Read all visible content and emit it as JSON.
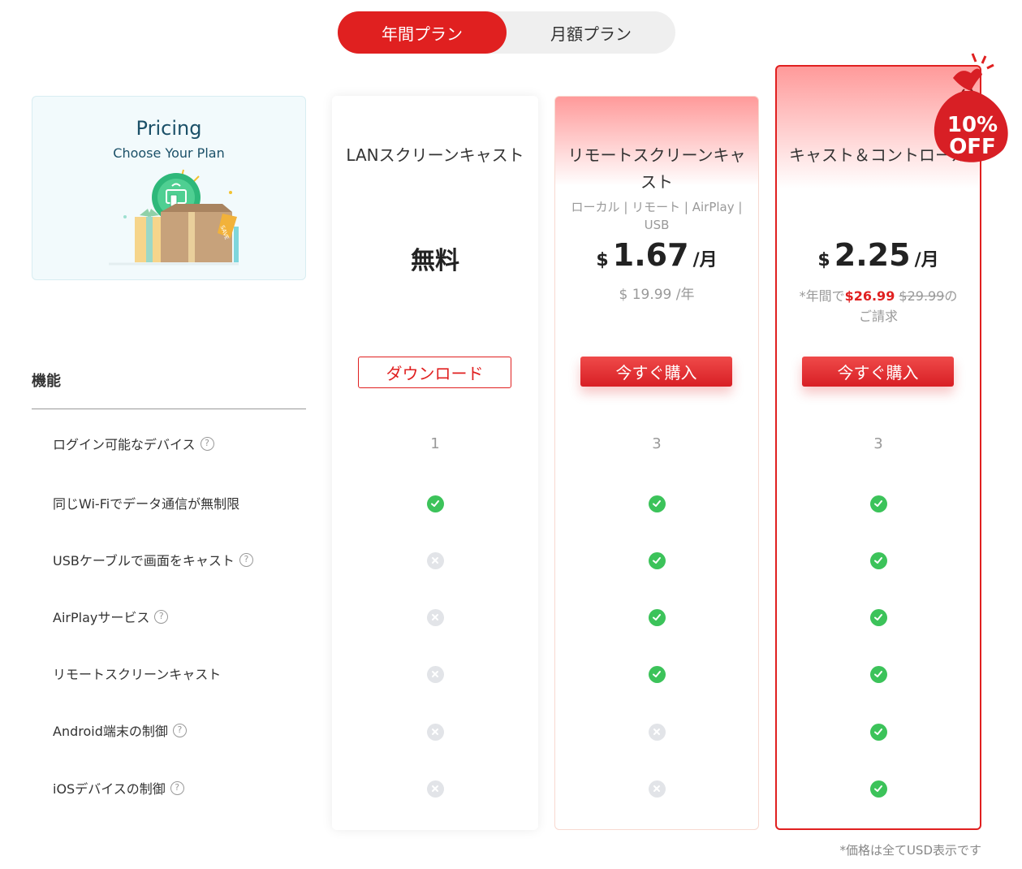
{
  "toggle": {
    "annual": "年間プラン",
    "monthly": "月額プラン"
  },
  "intro": {
    "title": "Pricing",
    "subtitle": "Choose Your Plan",
    "icon": "gift-box-illustration",
    "tag": "SAVE"
  },
  "features_heading": "機能",
  "features": [
    {
      "label": "ログイン可能なデバイス",
      "help": true
    },
    {
      "label": "同じWi-Fiでデータ通信が無制限",
      "help": false
    },
    {
      "label": "USBケーブルで画面をキャスト",
      "help": true
    },
    {
      "label": "AirPlayサービス",
      "help": true
    },
    {
      "label": "リモートスクリーンキャスト",
      "help": false
    },
    {
      "label": "Android端末の制御",
      "help": true
    },
    {
      "label": "iOSデバイスの制御",
      "help": true
    }
  ],
  "help_icon_text": "?",
  "plans": [
    {
      "name": "LANスクリーンキャスト",
      "price_text": "無料",
      "button": "ダウンロード",
      "devices": "1",
      "checks": [
        true,
        false,
        false,
        false,
        false,
        false
      ]
    },
    {
      "name_line1": "リモートスクリーンキャ",
      "name_line2": "スト",
      "desc_line1": "ローカル | リモート | AirPlay |",
      "desc_line2": "USB",
      "currency": "$",
      "amount": "1.67",
      "per": "/月",
      "yearly": "$ 19.99 /年",
      "button": "今すぐ購入",
      "devices": "3",
      "checks": [
        true,
        true,
        true,
        true,
        false,
        false
      ]
    },
    {
      "name": "キャスト＆コントロール",
      "currency": "$",
      "amount": "2.25",
      "per": "/月",
      "billing_prefix": "*年間で",
      "billing_sale": "$26.99",
      "billing_orig": "$29.99",
      "billing_suffix": "の",
      "billing_line2": "ご請求",
      "button": "今すぐ購入",
      "devices": "3",
      "checks": [
        true,
        true,
        true,
        true,
        true,
        true
      ],
      "badge_line1": "10%",
      "badge_line2": "OFF"
    }
  ],
  "note": "*価格は全てUSD表示です",
  "colors": {
    "accent": "#e02020",
    "check": "#3cc35a",
    "cross": "#e2e4e8",
    "intro_bg": "#f2fafc"
  }
}
